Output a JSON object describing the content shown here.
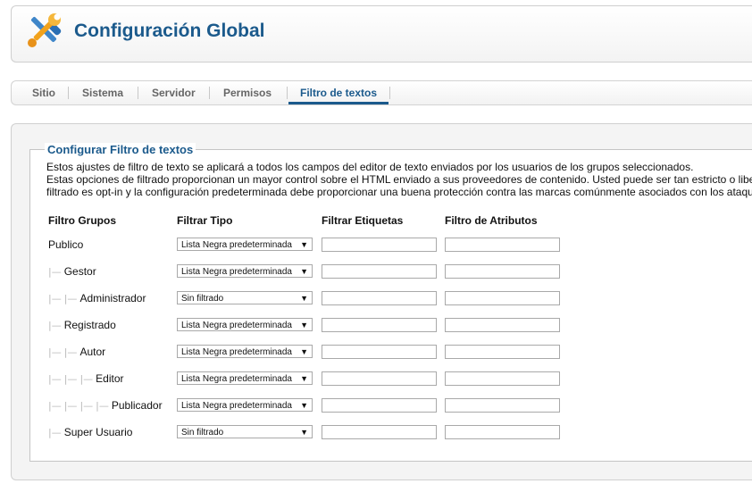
{
  "header": {
    "title": "Configuración Global",
    "icon": "tools-icon"
  },
  "tabs": [
    {
      "label": "Sitio",
      "active": false
    },
    {
      "label": "Sistema",
      "active": false
    },
    {
      "label": "Servidor",
      "active": false
    },
    {
      "label": "Permisos",
      "active": false
    },
    {
      "label": "Filtro de textos",
      "active": true
    }
  ],
  "section": {
    "legend": "Configurar Filtro de textos",
    "description": [
      "Estos ajustes de filtro de texto se aplicará a todos los campos del editor de texto enviados por los usuarios de los grupos seleccionados.",
      "Estas opciones de filtrado proporcionan un mayor control sobre el HTML enviado a sus proveedores de contenido. Usted puede ser tan estricto o liberal como usted necesite.",
      "filtrado es opt-in y la configuración predeterminada debe proporcionar una buena protección contra las marcas comúnmente asociados con los ataques."
    ]
  },
  "table": {
    "headers": [
      "Filtro Grupos",
      "Filtrar Tipo",
      "Filtrar Etiquetas",
      "Filtro de Atributos"
    ],
    "rows": [
      {
        "group": "Publico",
        "depth": 0,
        "filter_type": "Lista Negra predeterminada",
        "tags": "",
        "attributes": ""
      },
      {
        "group": "Gestor",
        "depth": 1,
        "filter_type": "Lista Negra predeterminada",
        "tags": "",
        "attributes": ""
      },
      {
        "group": "Administrador",
        "depth": 2,
        "filter_type": "Sin filtrado",
        "tags": "",
        "attributes": ""
      },
      {
        "group": "Registrado",
        "depth": 1,
        "filter_type": "Lista Negra predeterminada",
        "tags": "",
        "attributes": ""
      },
      {
        "group": "Autor",
        "depth": 2,
        "filter_type": "Lista Negra predeterminada",
        "tags": "",
        "attributes": ""
      },
      {
        "group": "Editor",
        "depth": 3,
        "filter_type": "Lista Negra predeterminada",
        "tags": "",
        "attributes": ""
      },
      {
        "group": "Publicador",
        "depth": 4,
        "filter_type": "Lista Negra predeterminada",
        "tags": "",
        "attributes": ""
      },
      {
        "group": "Super Usuario",
        "depth": 1,
        "filter_type": "Sin filtrado",
        "tags": "",
        "attributes": ""
      }
    ]
  },
  "colors": {
    "accent": "#1b5a8c",
    "tab_inactive": "#666666",
    "tree_line": "#b8b8b8"
  }
}
